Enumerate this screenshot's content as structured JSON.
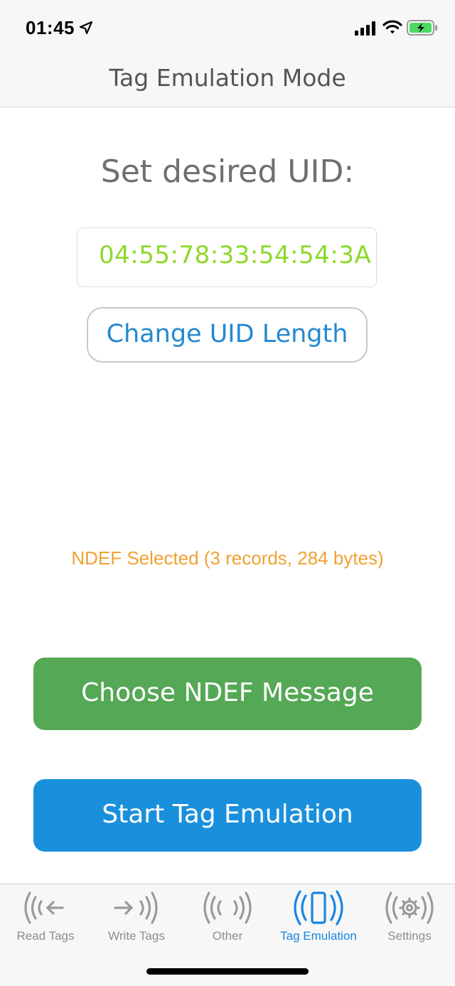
{
  "status_bar": {
    "time": "01:45",
    "icons": [
      "location-arrow-icon",
      "cellular-signal-icon",
      "wifi-icon",
      "battery-charging-icon"
    ],
    "battery_color": "#4cd964"
  },
  "nav": {
    "title": "Tag Emulation Mode"
  },
  "main": {
    "uid_heading": "Set desired UID:",
    "uid_value": "04:55:78:33:54:54:3A",
    "change_uid_length_label": "Change UID Length",
    "ndef_status": "NDEF Selected (3 records, 284 bytes)",
    "choose_ndef_label": "Choose NDEF Message",
    "start_emulation_label": "Start Tag Emulation"
  },
  "colors": {
    "uid_value": "#8dd82a",
    "link_blue": "#2588d1",
    "ndef_status": "#f0a131",
    "choose_button": "#55a855",
    "start_button": "#1a90dc",
    "tab_active": "#1b84e0",
    "tab_inactive": "#8e8e8e"
  },
  "tabs": [
    {
      "label": "Read Tags",
      "icon": "read-tags-icon",
      "active": false
    },
    {
      "label": "Write Tags",
      "icon": "write-tags-icon",
      "active": false
    },
    {
      "label": "Other",
      "icon": "other-icon",
      "active": false
    },
    {
      "label": "Tag Emulation",
      "icon": "tag-emulation-icon",
      "active": true
    },
    {
      "label": "Settings",
      "icon": "settings-icon",
      "active": false
    }
  ]
}
